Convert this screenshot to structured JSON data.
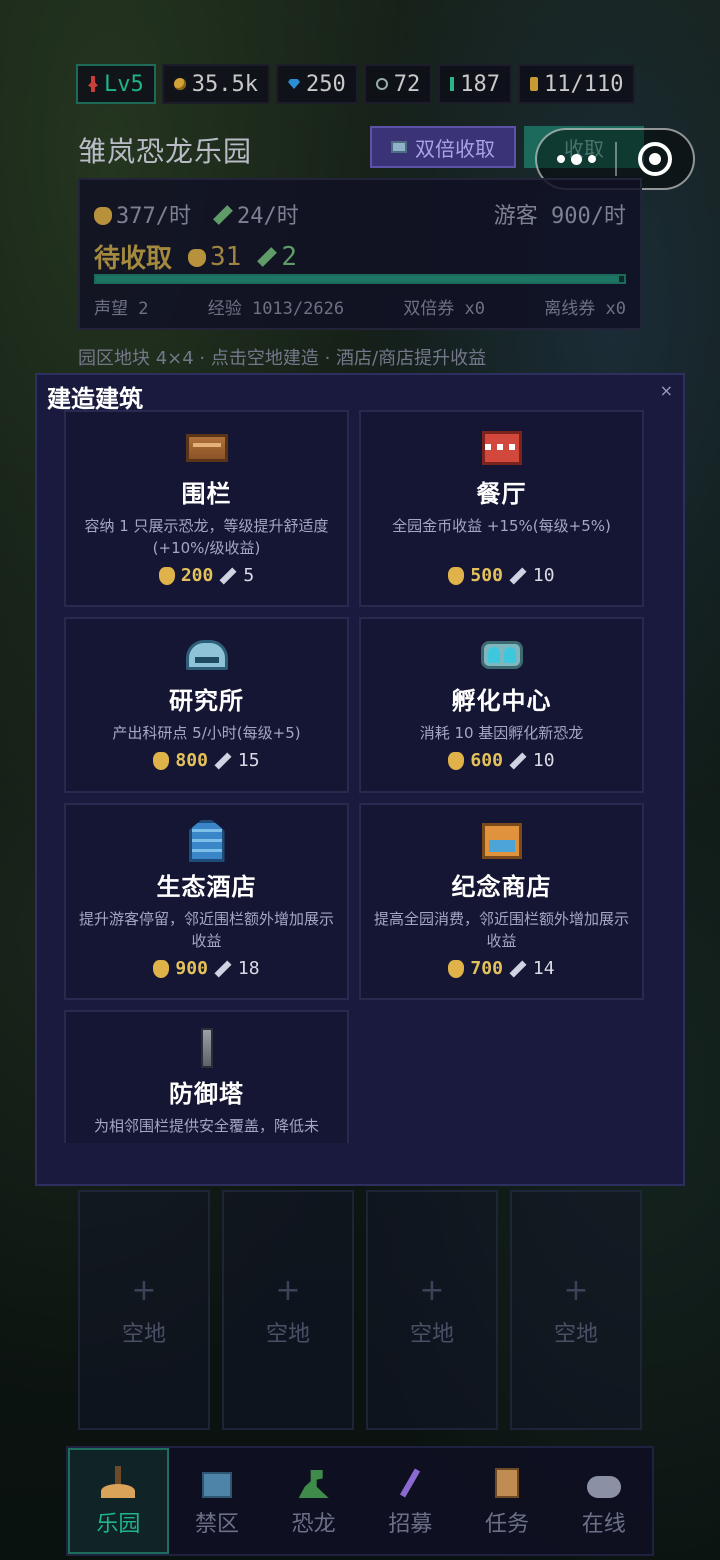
{
  "status": {
    "level": "Lv5",
    "coins": "35.5k",
    "gems": "250",
    "ring": "72",
    "energy": "187",
    "capacity": "11/110"
  },
  "park": {
    "name": "雏岚恐龙乐园",
    "double_collect": "双倍收取",
    "collect": "收取",
    "gold_rate": "377/时",
    "research_rate": "24/时",
    "visitors": "游客 900/时",
    "pending_label": "待收取",
    "pending_gold": "31",
    "pending_research": "2",
    "progress_fraction": 0.99,
    "reputation": "声望 2",
    "experience": "经验 1013/2626",
    "double_ticket": "双倍券 x0",
    "offline_ticket": "离线券 x0",
    "hint": "园区地块 4×4 · 点击空地建造 · 酒店/商店提升收益"
  },
  "modal": {
    "title": "建造建筑",
    "close": "×",
    "buildings": [
      {
        "name": "围栏",
        "desc": "容纳 1 只展示恐龙，等级提升舒适度(+10%/级收益)",
        "gold": "200",
        "research": "5",
        "icon": "fence-icon"
      },
      {
        "name": "餐厅",
        "desc": "全园金币收益 +15%(每级+5%)",
        "gold": "500",
        "research": "10",
        "icon": "restaurant-icon"
      },
      {
        "name": "研究所",
        "desc": "产出科研点 5/小时(每级+5)",
        "gold": "800",
        "research": "15",
        "icon": "lab-icon"
      },
      {
        "name": "孵化中心",
        "desc": "消耗 10 基因孵化新恐龙",
        "gold": "600",
        "research": "10",
        "icon": "hatchery-icon"
      },
      {
        "name": "生态酒店",
        "desc": "提升游客停留，邻近围栏额外增加展示收益",
        "gold": "900",
        "research": "18",
        "icon": "hotel-icon"
      },
      {
        "name": "纪念商店",
        "desc": "提高全园消费，邻近围栏额外增加展示收益",
        "gold": "700",
        "research": "14",
        "icon": "shop-icon"
      },
      {
        "name": "防御塔",
        "desc": "为相邻围栏提供安全覆盖，降低未",
        "gold": "",
        "research": "",
        "icon": "tower-icon"
      }
    ]
  },
  "lots": [
    "空地",
    "空地",
    "空地",
    "空地"
  ],
  "nav": [
    "乐园",
    "禁区",
    "恐龙",
    "招募",
    "任务",
    "在线"
  ]
}
